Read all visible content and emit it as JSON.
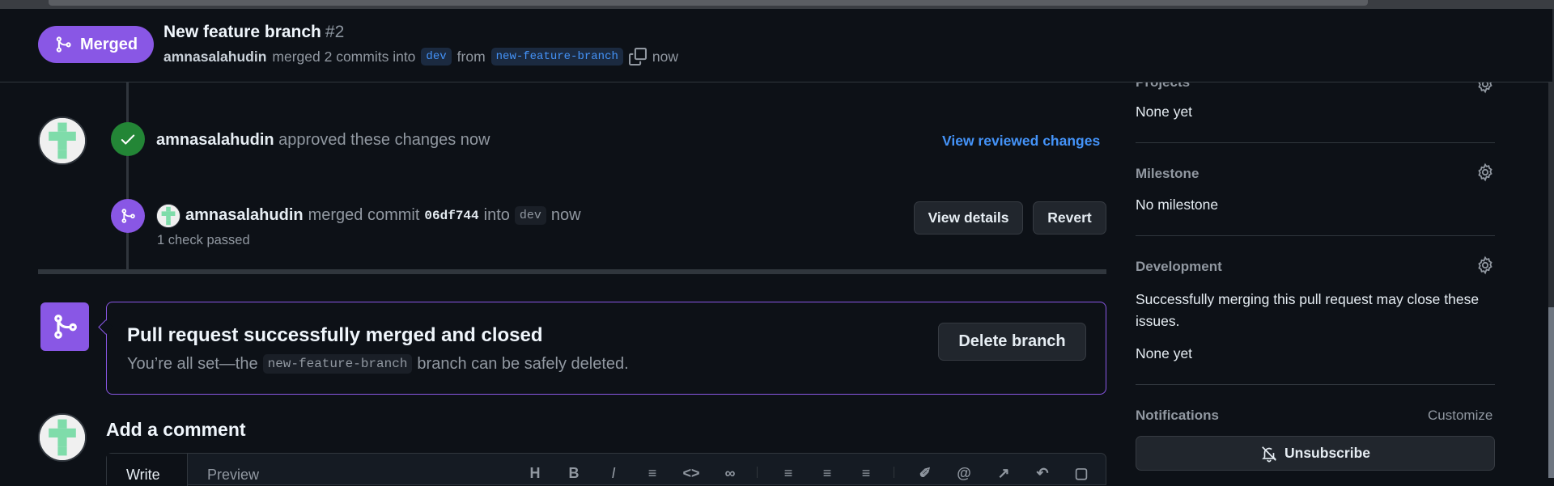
{
  "header": {
    "status_label": "Merged",
    "title": "New feature branch",
    "number": "#2",
    "author": "amnasalahudin",
    "merged_text": "merged 2 commits into",
    "base_branch": "dev",
    "from_text": "from",
    "head_branch": "new-feature-branch",
    "time": "now"
  },
  "timeline": {
    "approval": {
      "user": "amnasalahudin",
      "text": "approved these changes now",
      "link": "View reviewed changes"
    },
    "merge_event": {
      "user": "amnasalahudin",
      "merged_text": "merged commit",
      "sha": "06df744",
      "into_text": "into",
      "branch": "dev",
      "time": "now",
      "checks": "1 check passed",
      "view_details": "View details",
      "revert": "Revert"
    }
  },
  "merge_box": {
    "title": "Pull request successfully merged and closed",
    "sub_prefix": "You’re all set—the",
    "branch": "new-feature-branch",
    "sub_suffix": "branch can be safely deleted.",
    "delete_button": "Delete branch"
  },
  "comment": {
    "title": "Add a comment",
    "write_tab": "Write",
    "preview_tab": "Preview"
  },
  "sidebar": {
    "projects": {
      "label": "Projects",
      "value": "None yet"
    },
    "milestone": {
      "label": "Milestone",
      "value": "No milestone"
    },
    "development": {
      "label": "Development",
      "description": "Successfully merging this pull request may close these issues.",
      "value": "None yet"
    },
    "notifications": {
      "label": "Notifications",
      "customize": "Customize",
      "unsubscribe": "Unsubscribe"
    }
  },
  "colors": {
    "background": "#0d1117",
    "merged_purple": "#8957e5",
    "approved_green": "#238636",
    "link_blue": "#4493f8",
    "border": "#30363d"
  }
}
